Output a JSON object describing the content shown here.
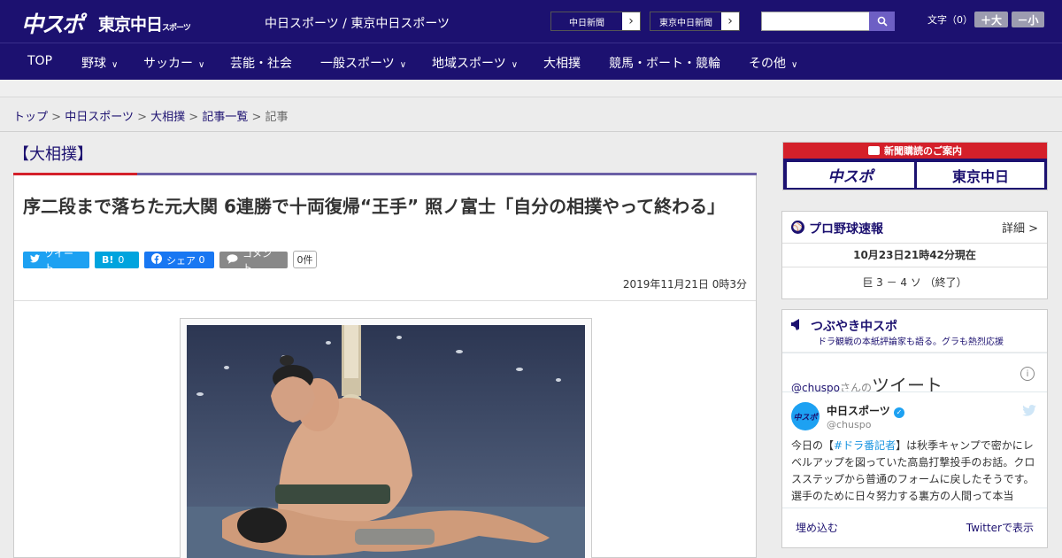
{
  "header": {
    "logo_chuspo": "中スポ",
    "logo_tokyo": "東京中日",
    "logo_tokyo_sub": "スポーツ",
    "site_title": "中日スポーツ / 東京中日スポーツ",
    "paper_buttons": [
      "中日新聞",
      "東京中日新聞"
    ],
    "search_placeholder": "",
    "font_size_label": "文字（0）",
    "font_bigger": "＋大",
    "font_smaller": "－小"
  },
  "nav": [
    {
      "label": "TOP"
    },
    {
      "label": "野球",
      "dropdown": true
    },
    {
      "label": "サッカー",
      "dropdown": true
    },
    {
      "label": "芸能・社会"
    },
    {
      "label": "一般スポーツ",
      "dropdown": true
    },
    {
      "label": "地域スポーツ",
      "dropdown": true
    },
    {
      "label": "大相撲"
    },
    {
      "label": "競馬・ボート・競輪"
    },
    {
      "label": "その他",
      "dropdown": true
    }
  ],
  "breadcrumb": {
    "items": [
      "トップ",
      "中日スポーツ",
      "大相撲",
      "記事一覧"
    ],
    "current": "記事",
    "separator": ">"
  },
  "article": {
    "category": "【大相撲】",
    "headline": "序二段まで落ちた元大関 6連勝で十両復帰“王手” 照ノ富士「自分の相撲やって終わる」",
    "share": {
      "tweet": "ツイート",
      "hatena": "B!",
      "hatena_count": "0",
      "facebook": "シェア",
      "facebook_count": "0",
      "comment": "コメント",
      "comment_count": "0件"
    },
    "date": "2019年11月21日 0時3分"
  },
  "sidebar": {
    "subscribe_banner": "新聞購読のご案内",
    "subscribe_chuspo": "中スポ",
    "subscribe_tokyo": "東京中日",
    "baseball": {
      "title": "プロ野球速報",
      "detail": "詳細 >",
      "updated": "10月23日21時42分現在",
      "score": "巨 3 － 4 ソ （終了）"
    },
    "tsubuyaki": {
      "title": "つぶやき中スポ",
      "subtitle": "ドラ観戦の本紙評論家も語る。グラも熱烈応援",
      "handle_prefix": "@chuspo",
      "handle_suffix": "さんの",
      "tweets_label": "ツイート",
      "account_name": "中日スポーツ",
      "account_handle": "@chuspo",
      "tweet_pre": "今日の【",
      "tweet_hashtag": "#ドラ番記者",
      "tweet_post": "】は秋季キャンプで密かにレベルアップを図っていた高島打撃投手のお話。クロスステップから普通のフォームに戻したそうです。選手のために日々努力する裏方の人間って本当",
      "embed": "埋め込む",
      "view_on_twitter": "Twitterで表示"
    }
  },
  "colors": {
    "brand": "#1c1170",
    "accent_red": "#d4202a",
    "twitter": "#1da1f2",
    "hatena": "#00a4de",
    "facebook": "#1877f2"
  }
}
